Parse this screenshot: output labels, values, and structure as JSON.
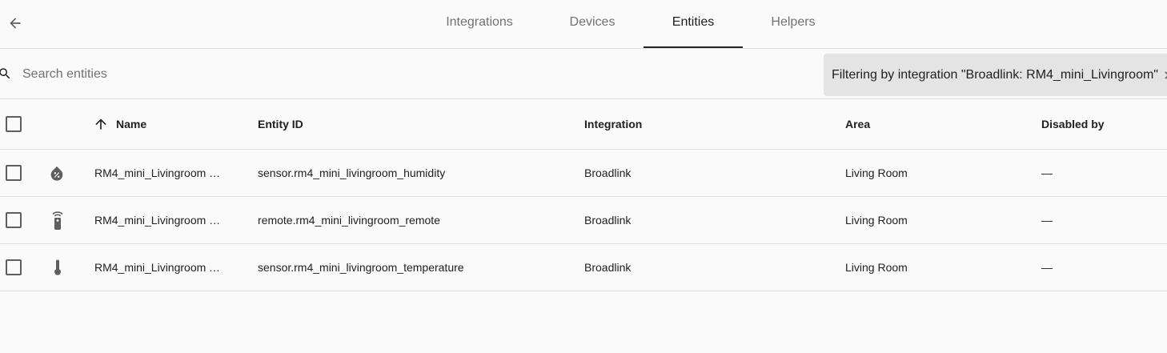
{
  "tabs": [
    {
      "label": "Integrations",
      "active": false
    },
    {
      "label": "Devices",
      "active": false
    },
    {
      "label": "Entities",
      "active": true
    },
    {
      "label": "Helpers",
      "active": false
    }
  ],
  "search": {
    "placeholder": "Search entities",
    "value": "",
    "filter_label": "Filtering by integration \"Broadlink: RM4_mini_Livingroom\""
  },
  "table": {
    "columns": {
      "name": "Name",
      "entity_id": "Entity ID",
      "integration": "Integration",
      "area": "Area",
      "disabled_by": "Disabled by"
    },
    "sort": {
      "column": "name",
      "direction": "ascending"
    },
    "rows": [
      {
        "icon": "water-percent-icon",
        "name": "RM4_mini_Livingroom H…",
        "entity_id": "sensor.rm4_mini_livingroom_humidity",
        "integration": "Broadlink",
        "area": "Living Room",
        "disabled_by": "—"
      },
      {
        "icon": "remote-icon",
        "name": "RM4_mini_Livingroom R…",
        "entity_id": "remote.rm4_mini_livingroom_remote",
        "integration": "Broadlink",
        "area": "Living Room",
        "disabled_by": "—"
      },
      {
        "icon": "thermometer-icon",
        "name": "RM4_mini_Livingroom T…",
        "entity_id": "sensor.rm4_mini_livingroom_temperature",
        "integration": "Broadlink",
        "area": "Living Room",
        "disabled_by": "—"
      }
    ]
  },
  "colors": {
    "background": "#fafafa",
    "divider": "#e0e0e0",
    "tab_inactive": "#727272",
    "tab_active": "#212121",
    "chip_background": "#e4e4e4",
    "icon": "#5f5f5f"
  }
}
